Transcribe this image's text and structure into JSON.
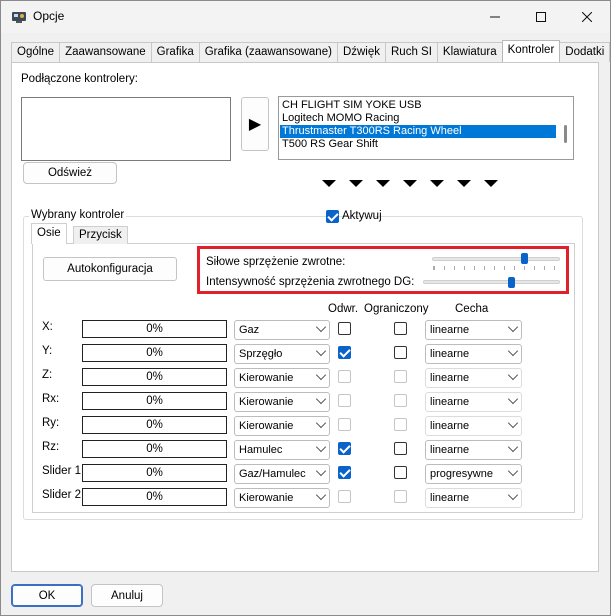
{
  "window": {
    "title": "Opcje"
  },
  "tabs": [
    {
      "label": "Ogólne",
      "active": false
    },
    {
      "label": "Zaawansowane",
      "active": false
    },
    {
      "label": "Grafika",
      "active": false
    },
    {
      "label": "Grafika (zaawansowane)",
      "active": false
    },
    {
      "label": "Dźwięk",
      "active": false
    },
    {
      "label": "Ruch SI",
      "active": false
    },
    {
      "label": "Klawiatura",
      "active": false
    },
    {
      "label": "Kontroler",
      "active": true
    },
    {
      "label": "Dodatki",
      "active": false
    }
  ],
  "connected": {
    "label": "Podłączone kontrolery:",
    "refresh_button": "Odśwież",
    "transfer_button": "▶",
    "available": [
      {
        "name": "CH FLIGHT SIM YOKE USB",
        "selected": false
      },
      {
        "name": "Logitech MOMO Racing",
        "selected": false
      },
      {
        "name": "Thrustmaster T300RS Racing Wheel",
        "selected": true
      },
      {
        "name": "T500 RS Gear Shift",
        "selected": false
      }
    ]
  },
  "selected_controller": {
    "group_label": "Wybrany kontroler",
    "activate_label": "Aktywuj",
    "activate_checked": true,
    "subtabs": [
      {
        "label": "Osie",
        "active": true
      },
      {
        "label": "Przycisk",
        "active": false
      }
    ],
    "autoconfig_button": "Autokonfiguracja",
    "ffb": {
      "force_feedback_label": "Siłowe sprzężenie zwrotne:",
      "force_feedback_level": 0.72,
      "dg_intensity_label": "Intensywność sprzężenia zwrotnego DG:",
      "dg_intensity_level": 0.64
    },
    "columns": {
      "invert": "Odwr.",
      "limit": "Ograniczony",
      "curve": "Cecha"
    },
    "axes": [
      {
        "axis": "X:",
        "value": "0%",
        "function": "Gaz",
        "invert": false,
        "invert_enabled": true,
        "limit": false,
        "limit_enabled": true,
        "curve": "linearne",
        "curve_enabled": true
      },
      {
        "axis": "Y:",
        "value": "0%",
        "function": "Sprzęgło",
        "invert": true,
        "invert_enabled": true,
        "limit": false,
        "limit_enabled": true,
        "curve": "linearne",
        "curve_enabled": true
      },
      {
        "axis": "Z:",
        "value": "0%",
        "function": "Kierowanie",
        "invert": false,
        "invert_enabled": false,
        "limit": false,
        "limit_enabled": false,
        "curve": "linearne",
        "curve_enabled": false
      },
      {
        "axis": "Rx:",
        "value": "0%",
        "function": "Kierowanie",
        "invert": false,
        "invert_enabled": false,
        "limit": false,
        "limit_enabled": false,
        "curve": "linearne",
        "curve_enabled": false
      },
      {
        "axis": "Ry:",
        "value": "0%",
        "function": "Kierowanie",
        "invert": false,
        "invert_enabled": false,
        "limit": false,
        "limit_enabled": false,
        "curve": "linearne",
        "curve_enabled": false
      },
      {
        "axis": "Rz:",
        "value": "0%",
        "function": "Hamulec",
        "invert": true,
        "invert_enabled": true,
        "limit": false,
        "limit_enabled": true,
        "curve": "linearne",
        "curve_enabled": true
      },
      {
        "axis": "Slider 1:",
        "value": "0%",
        "function": "Gaz/Hamulec",
        "invert": true,
        "invert_enabled": true,
        "limit": false,
        "limit_enabled": true,
        "curve": "progresywne",
        "curve_enabled": true
      },
      {
        "axis": "Slider 2:",
        "value": "0%",
        "function": "Kierowanie",
        "invert": false,
        "invert_enabled": false,
        "limit": false,
        "limit_enabled": false,
        "curve": "linearne",
        "curve_enabled": false
      }
    ]
  },
  "footer": {
    "ok": "OK",
    "cancel": "Anuluj"
  },
  "colors": {
    "accent": "#0078d7",
    "highlight_border": "#e0202a"
  }
}
